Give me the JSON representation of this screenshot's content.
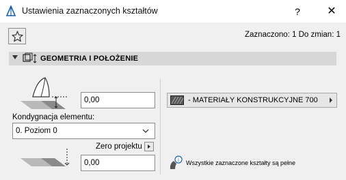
{
  "window": {
    "title": "Ustawienia zaznaczonych kształtów",
    "help_label": "?",
    "close_label": "✕"
  },
  "toolbar": {
    "favorites_icon": "star-icon",
    "status": "Zaznaczono: 1 Do zmian: 1"
  },
  "section": {
    "title": "GEOMETRIA I POŁOŻENIE",
    "icon": "geometry-icon"
  },
  "geometry": {
    "top_offset_value": "0,00",
    "story_label": "Kondygnacja elementu:",
    "story_value": "0. Poziom 0",
    "reference_label": "Zero projektu",
    "bottom_offset_value": "0,00"
  },
  "material": {
    "label": "- MATERIAŁY KONSTRUKCYJNE 700"
  },
  "info": {
    "text": "Wszystkie zaznaczone kształty są pełne"
  }
}
